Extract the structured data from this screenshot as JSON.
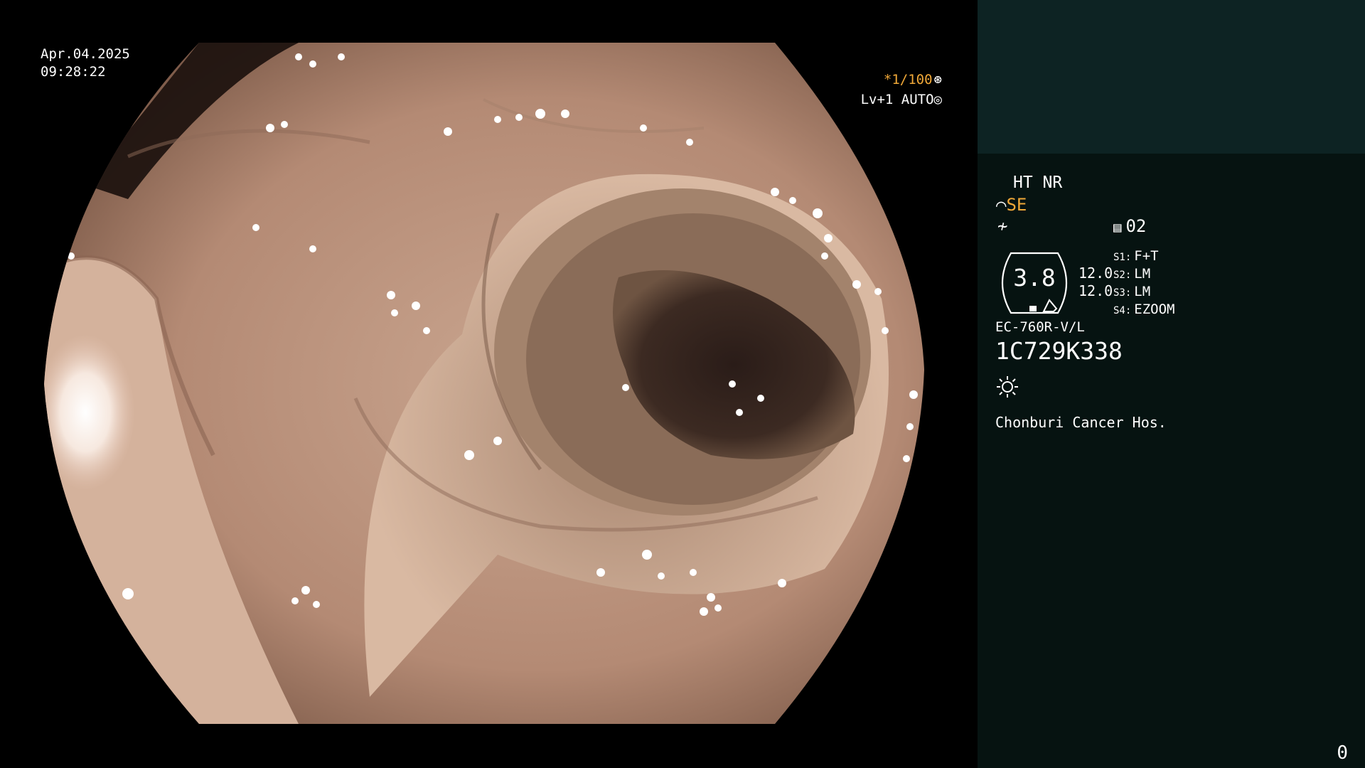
{
  "overlay": {
    "date": "Apr.04.2025",
    "time": "09:28:22",
    "shutter_prefix": "*",
    "shutter": "1/100",
    "shutter_icon": "aperture-icon",
    "exposure": "Lv+1 AUTO",
    "exposure_icon": "iris-icon"
  },
  "panel": {
    "ht_nr": "HT NR",
    "structure_enhance": "SE",
    "structure_icon": "structure-enhance-icon",
    "color_icon": "color-enhance-icon",
    "mode_icon": "memory-icon",
    "mode_value": "02",
    "dial_value": "3.8",
    "zoom_1": "12.0",
    "zoom_2": "12.0",
    "switches": [
      {
        "key": "S1:",
        "value": "F+T"
      },
      {
        "key": "S2:",
        "value": "LM"
      },
      {
        "key": "S3:",
        "value": "LM"
      },
      {
        "key": "S4:",
        "value": "EZOOM"
      }
    ],
    "scope_model": "EC-760R-V/L",
    "scope_serial": "1C729K338",
    "light_icon": "light-sun-icon",
    "hospital": "Chonburi Cancer Hos.",
    "corner_count": "0"
  },
  "colors": {
    "accent": "#f0a838",
    "panel_top": "#0d2323",
    "panel": "#061311",
    "mucosa": "#c9a58f"
  }
}
